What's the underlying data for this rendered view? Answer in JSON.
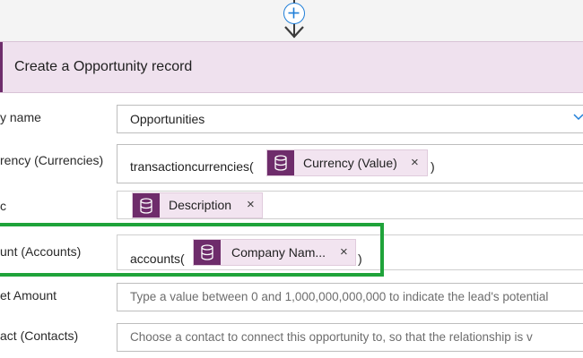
{
  "card": {
    "title": "Create a Opportunity record"
  },
  "fields": {
    "entity_name": {
      "label": "y name",
      "value": "Opportunities"
    },
    "currency": {
      "label": "rency (Currencies)",
      "prefix": "transactioncurrencies(",
      "token": "Currency (Value)",
      "suffix": ")"
    },
    "description": {
      "label": "c",
      "token": "Description"
    },
    "account": {
      "label": "unt (Accounts)",
      "prefix": "accounts(",
      "token": "Company Nam...",
      "suffix": ")"
    },
    "budget": {
      "label": "et Amount",
      "placeholder": "Type a value between 0 and 1,000,000,000,000 to indicate the lead's potential"
    },
    "contact": {
      "label": "act (Contacts)",
      "placeholder": "Choose a contact to connect this opportunity to, so that the relationship is v"
    }
  },
  "token_close_glyph": "×",
  "colors": {
    "accent": "#6e2c6b",
    "header_bg": "#efe1ee",
    "token_bg": "#f2e4f0",
    "highlight": "#1fa33a",
    "add_step": "#1f7ed8"
  },
  "icons": {
    "add_step": "plus-circle-icon",
    "connector": "arrow-down-icon",
    "token": "database-icon",
    "dropdown": "chevron-down-icon"
  }
}
